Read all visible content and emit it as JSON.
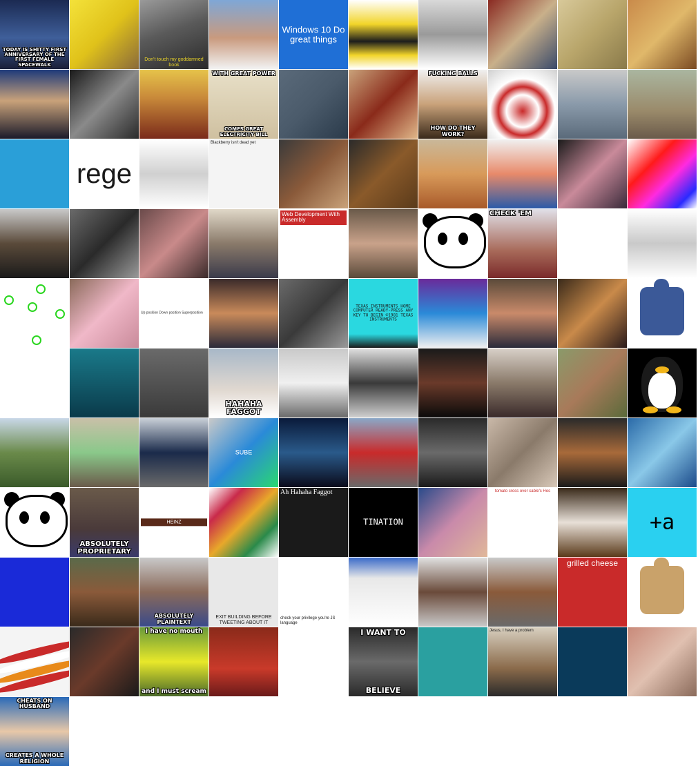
{
  "tiles": [
    {
      "name": "astronaut-group-photo",
      "bg": "linear-gradient(180deg,#1b2a52 0%,#3f5f9a 55%,#1a1f38 100%)",
      "cap_pos": "bottom",
      "cap_style": "meme",
      "cap_size": 7,
      "caption": "TODAY IS SHITTY FIRST ANNIVERSARY OF THE FIRST FEMALE SPACEWALK"
    },
    {
      "name": "yellow-mop-horse",
      "bg": "linear-gradient(135deg,#f4e23a 0%,#e0c21a 50%,#8a6a3a 100%)",
      "caption": ""
    },
    {
      "name": "black-book-on-floor",
      "bg": "linear-gradient(160deg,#9a9a9a 0%,#5a5a5a 45%,#2a2a2a 100%)",
      "cap_pos": "bottom",
      "cap_style": "plain",
      "cap_color": "#e8d22a",
      "cap_size": 7,
      "caption": "Don't touch my goddamned book"
    },
    {
      "name": "mother-teresa-portrait",
      "bg": "linear-gradient(180deg,#7fa7d6 0%,#c99a7e 55%,#f2f2f2 100%)",
      "caption": ""
    },
    {
      "name": "windows-10-banner",
      "bg": "#1f6fd6",
      "cap_pos": "center",
      "cap_style": "plain",
      "cap_color": "#ffffff",
      "cap_size": 13,
      "caption": "Windows 10 Do great things"
    },
    {
      "name": "bee-costume-figure",
      "bg": "linear-gradient(180deg,#ffffff 0%,#f2d52a 35%,#1c1c1c 60%,#f2d52a 80%,#ffffff 100%)",
      "caption": ""
    },
    {
      "name": "physicist-at-chalkboard",
      "bg": "linear-gradient(180deg,#d9d9d9 0%,#9a9a9a 50%,#ffffff 100%)",
      "caption": ""
    },
    {
      "name": "crowded-warehouse",
      "bg": "linear-gradient(135deg,#8a2a22 0%,#c9b08a 50%,#3a4a6a 100%)",
      "caption": ""
    },
    {
      "name": "isaac-newton-banknote",
      "bg": "linear-gradient(135deg,#d8c99a 0%,#b8a56a 50%,#8a7a4a 100%)",
      "caption": ""
    },
    {
      "name": "two-men-icon-painting",
      "bg": "linear-gradient(135deg,#c98a4a 0%,#e0b86a 50%,#7a4a22 100%)",
      "caption": ""
    },
    {
      "name": "politician-at-podium",
      "bg": "linear-gradient(180deg,#1e3a7a 0%,#c9a27a 45%,#1a1a2a 100%)",
      "caption": ""
    },
    {
      "name": "vintage-photo-child-and-man",
      "bg": "linear-gradient(135deg,#1a1a1a 0%,#8a8a8a 50%,#2a2a2a 100%)",
      "caption": ""
    },
    {
      "name": "fly-saint-icon-painting",
      "bg": "linear-gradient(180deg,#e6c34a 0%,#c98a3a 40%,#7a2a1a 100%)",
      "caption": ""
    },
    {
      "name": "confucius-meme",
      "bg": "linear-gradient(180deg,#e8e0c8 0%,#cfc0a0 100%)",
      "cap_pos": "top",
      "cap_style": "meme",
      "cap_size": 8,
      "caption": "WITH GREAT POWER",
      "cap2_pos": "bottom",
      "cap2_style": "meme",
      "cap2_size": 7,
      "caption2": "COMES GREAT ELECTRICITY BILL"
    },
    {
      "name": "black-puppy-on-floor",
      "bg": "linear-gradient(135deg,#5a6a7a 0%,#4a5a6a 50%,#2a3a4a 100%)",
      "caption": ""
    },
    {
      "name": "feet-in-slippers",
      "bg": "linear-gradient(135deg,#c9a27a 0%,#8a2a1a 50%,#e0b88a 100%)",
      "caption": ""
    },
    {
      "name": "dog-with-balls-meme",
      "bg": "linear-gradient(180deg,#f0f0f0 0%,#c9a27a 50%,#3a2a1a 100%)",
      "cap_pos": "top",
      "cap_style": "meme",
      "cap_size": 8,
      "caption": "FUCKING BALLS",
      "cap2_pos": "bottom",
      "cap2_style": "meme",
      "cap2_size": 8,
      "caption2": "HOW DO THEY WORK?"
    },
    {
      "name": "toy-helicopter-target",
      "bg": "radial-gradient(circle at 50% 60%,#c92a2a 0%,#ffffff 30%,#c92a2a 45%,#ffffff 60%,#d0d0d0 100%)",
      "caption": ""
    },
    {
      "name": "crowd-of-people-blurred",
      "bg": "linear-gradient(180deg,#c9c9c9 0%,#8a9aaa 50%,#5a6a7a 100%)",
      "caption": ""
    },
    {
      "name": "dog-on-street",
      "bg": "linear-gradient(180deg,#aab6a0 0%,#9a8a6a 60%,#6a5a4a 100%)",
      "caption": ""
    },
    {
      "name": "telegram-logo",
      "bg": "#2a9fd8",
      "caption": ""
    },
    {
      "name": "rege-text-tile",
      "bg": "#ffffff",
      "cap_pos": "center",
      "cap_style": "plain",
      "cap_color": "#1a1a1a",
      "cap_size": 40,
      "caption": "rege"
    },
    {
      "name": "comic-strip-panels",
      "bg": "linear-gradient(180deg,#ffffff 0%,#d0d0d0 50%,#ffffff 100%)",
      "caption": ""
    },
    {
      "name": "blackberry-note",
      "bg": "#f4f4f4",
      "cap_pos": "top",
      "cap_style": "plain",
      "cap_color": "#1a1a1a",
      "cap_size": 6,
      "cap_align": "left",
      "caption": "Blackberry isn't dead yet"
    },
    {
      "name": "cake-slice-photo",
      "bg": "linear-gradient(135deg,#3a3a3a 0%,#8a5a3a 50%,#c9a27a 100%)",
      "caption": ""
    },
    {
      "name": "dachshund-at-table",
      "bg": "linear-gradient(135deg,#2a2a2a 0%,#8a5a2a 50%,#5a3a1a 100%)",
      "caption": ""
    },
    {
      "name": "hotdog-dog",
      "bg": "linear-gradient(180deg,#c9b89a 0%,#d89a5a 50%,#a85a2a 100%)",
      "caption": ""
    },
    {
      "name": "cartoon-old-man",
      "bg": "linear-gradient(180deg,#f0f0f0 0%,#e88a6a 50%,#2a5aa8 100%)",
      "caption": ""
    },
    {
      "name": "two-people-expo",
      "bg": "linear-gradient(135deg,#1a1a1a 0%,#c98a9a 50%,#3a2a3a 100%)",
      "caption": ""
    },
    {
      "name": "colorful-geometric-pattern",
      "bg": "linear-gradient(135deg,#ffffff 0%,#ff1a1a 35%,#ff2ae0 60%,#2a2aff 85%,#ffffff 100%)",
      "caption": ""
    },
    {
      "name": "leader-portrait",
      "bg": "linear-gradient(180deg,#c9c9c9 0%,#5a4a3a 50%,#1a1a1a 100%)",
      "caption": ""
    },
    {
      "name": "robot-dog-parts",
      "bg": "linear-gradient(135deg,#6a6a6a 0%,#2a2a2a 50%,#9a9a9a 100%)",
      "caption": ""
    },
    {
      "name": "pig-close-up",
      "bg": "linear-gradient(135deg,#6a4a4a 0%,#c98a8a 50%,#3a2a2a 100%)",
      "caption": ""
    },
    {
      "name": "office-workers-desk",
      "bg": "linear-gradient(180deg,#e0d8c8 0%,#8a7a6a 50%,#3a3a4a 100%)",
      "caption": ""
    },
    {
      "name": "web-development-book-cover",
      "bg": "#ffffff",
      "cap_pos": "top",
      "cap_style": "plain",
      "cap_color": "#ffffff",
      "cap_bg": "#c92a2a",
      "cap_size": 8,
      "cap_align": "left",
      "caption": "Web Development With Assembly"
    },
    {
      "name": "close-up-face-portrait",
      "bg": "linear-gradient(180deg,#6a5a4a 0%,#c9a28a 50%,#5a4a3a 100%)",
      "caption": ""
    },
    {
      "name": "panda-drawing",
      "bg": "#ffffff",
      "panda": true,
      "caption": ""
    },
    {
      "name": "check-em-meme",
      "bg": "linear-gradient(180deg,#e0e0e8 0%,#a86a5a 60%,#7a2a2a 100%)",
      "cap_pos": "top",
      "cap_style": "meme",
      "cap_size": 10,
      "cap_align": "left",
      "caption": "CHECK 'EM"
    },
    {
      "name": "tweet-screenshot",
      "bg": "#ffffff",
      "cap_pos": "top",
      "cap_style": "plain",
      "cap_color": "#555555",
      "cap_size": 6,
      "cap_align": "left",
      "caption": ""
    },
    {
      "name": "sketch-illustration",
      "bg": "linear-gradient(180deg,#ffffff 0%,#c9c9c9 50%,#ffffff 100%)",
      "caption": ""
    },
    {
      "name": "green-circles",
      "bg": "#ffffff",
      "circles": true,
      "caption": ""
    },
    {
      "name": "woman-with-cat-ears",
      "bg": "linear-gradient(135deg,#8a6a5a 0%,#f0b8c8 50%,#c98a9a 100%)",
      "caption": ""
    },
    {
      "name": "usb-positions-diagram",
      "bg": "#ffffff",
      "cap_pos": "center",
      "cap_style": "plain",
      "cap_color": "#333333",
      "cap_size": 5,
      "cap_align": "left",
      "caption": "Up position Down position Superposition"
    },
    {
      "name": "family-in-costumes",
      "bg": "linear-gradient(180deg,#3a2a2a 0%,#c98a5a 50%,#2a2a3a 100%)",
      "caption": ""
    },
    {
      "name": "mech-robot-statue",
      "bg": "linear-gradient(135deg,#6a6a6a 0%,#3a3a3a 50%,#9a9a9a 100%)",
      "caption": ""
    },
    {
      "name": "texas-instruments-screen",
      "bg": "linear-gradient(180deg,#2ad8e0 0%,#2ad8e0 80%,#1a1a1a 100%)",
      "cap_pos": "center",
      "cap_style": "plain",
      "cap_color": "#1a1a1a",
      "cap_size": 6,
      "cap_extra": "mono",
      "caption": "TEXAS INSTRUMENTS HOME COMPUTER READY-PRESS ANY KEY TO BEGIN ©1981 TEXAS INSTRUMENTS"
    },
    {
      "name": "purple-website-screenshot",
      "bg": "linear-gradient(180deg,#6a2a9a 0%,#2a8ad8 50%,#f0f0f0 100%)",
      "caption": ""
    },
    {
      "name": "man-at-desk-office",
      "bg": "linear-gradient(180deg,#5a4a3a 0%,#c98a6a 50%,#2a2a3a 100%)",
      "caption": ""
    },
    {
      "name": "electronics-on-table",
      "bg": "linear-gradient(135deg,#3a2a1a 0%,#c98a4a 50%,#2a1a1a 100%)",
      "caption": ""
    },
    {
      "name": "broken-thumbs-up-icon",
      "bg": "#ffffff",
      "thumb": "bandaged",
      "caption": ""
    },
    {
      "name": "biology-diagram-cat-woman",
      "bg": "#ffffff",
      "caption": ""
    },
    {
      "name": "underwater-dog",
      "bg": "linear-gradient(180deg,#1a7a8a 0%,#0a3a4a 100%)",
      "caption": ""
    },
    {
      "name": "group-of-men-room",
      "bg": "linear-gradient(180deg,#6a6a6a 0%,#3a3a3a 100%)",
      "caption": ""
    },
    {
      "name": "pope-laughing-meme",
      "bg": "linear-gradient(180deg,#a8b8c8 0%,#e0d8d0 60%,#ffffff 100%)",
      "cap_pos": "bottom",
      "cap_style": "meme",
      "cap_size": 11,
      "caption": "HAHAHA FAGGOT"
    },
    {
      "name": "news-van",
      "bg": "linear-gradient(180deg,#c9c9c9 0%,#f0f0f0 50%,#6a6a6a 100%)",
      "caption": ""
    },
    {
      "name": "isaac-newton-engraving",
      "bg": "linear-gradient(180deg,#e0e0e0 0%,#3a3a3a 50%,#d0d0d0 100%)",
      "caption": ""
    },
    {
      "name": "chocolate-bunny",
      "bg": "linear-gradient(180deg,#1a1a1a 0%,#6a3a2a 50%,#0a0a0a 100%)",
      "caption": ""
    },
    {
      "name": "conference-presenter",
      "bg": "linear-gradient(180deg,#d8d0c8 0%,#8a7a6a 50%,#3a2a2a 100%)",
      "caption": ""
    },
    {
      "name": "monkey-in-field",
      "bg": "linear-gradient(135deg,#8a9a6a 0%,#a87a5a 50%,#5a6a3a 100%)",
      "caption": ""
    },
    {
      "name": "linux-tux-penguin",
      "bg": "#000000",
      "tux": true,
      "caption": ""
    },
    {
      "name": "boy-with-blue-barrel",
      "bg": "linear-gradient(180deg,#c9d8e8 0%,#6a8a4a 50%,#3a5a2a 100%)",
      "caption": ""
    },
    {
      "name": "sticky-notes-office",
      "bg": "linear-gradient(180deg,#c9c0a8 0%,#8ac88a 50%,#6a5a4a 100%)",
      "caption": ""
    },
    {
      "name": "police-on-motorcycles",
      "bg": "linear-gradient(180deg,#c9d0d8 0%,#1a2a4a 50%,#6a6a6a 100%)",
      "caption": ""
    },
    {
      "name": "sube-card-hand",
      "bg": "linear-gradient(135deg,#c9c9c9 0%,#2a8ad8 50%,#2ad870 100%)",
      "cap_pos": "center",
      "cap_style": "plain",
      "cap_color": "#ffffff",
      "cap_size": 9,
      "caption": "SUBE"
    },
    {
      "name": "ship-in-storm",
      "bg": "linear-gradient(180deg,#0a1a3a 0%,#2a5a8a 50%,#0a0a1a 100%)",
      "caption": ""
    },
    {
      "name": "wrecked-train-cars",
      "bg": "linear-gradient(180deg,#8aa8c8 0%,#c92a2a 50%,#6a6a6a 100%)",
      "caption": ""
    },
    {
      "name": "cracked-laptop",
      "bg": "linear-gradient(180deg,#2a2a2a 0%,#6a6a6a 50%,#1a1a1a 100%)",
      "caption": ""
    },
    {
      "name": "sleeping-cat-grenade",
      "bg": "linear-gradient(135deg,#c9b8a8 0%,#8a7a6a 50%,#d8c8b8 100%)",
      "caption": ""
    },
    {
      "name": "dog-close-up",
      "bg": "linear-gradient(180deg,#2a2a2a 0%,#a86a3a 50%,#1a1a1a 100%)",
      "caption": ""
    },
    {
      "name": "airplane-contrail",
      "bg": "linear-gradient(135deg,#2a6aa8 0%,#8ac8e8 50%,#1a4a8a 100%)",
      "caption": ""
    },
    {
      "name": "panda-sketch-window",
      "bg": "#ffffff",
      "panda": true,
      "caption": ""
    },
    {
      "name": "absolutely-proprietary-meme",
      "bg": "linear-gradient(180deg,#6a5a4a 0%,#4a3a3a 60%,#3a3a6a 100%)",
      "cap_pos": "bottom",
      "cap_style": "meme",
      "cap_size": 10,
      "caption": "ABSOLUTELY PROPRIETARY"
    },
    {
      "name": "heinz-sauce-bottle",
      "bg": "#ffffff",
      "cap_pos": "center",
      "cap_style": "plain",
      "cap_color": "#ffffff",
      "cap_bg": "#5a2a1a",
      "cap_size": 7,
      "caption": "HEINZ"
    },
    {
      "name": "dice-grid-pattern",
      "bg": "linear-gradient(135deg,#ffffff 0%,#c92a4a 25%,#e8a82a 50%,#2a8a4a 75%,#ffffff 100%)",
      "caption": ""
    },
    {
      "name": "mother-teresa-meme",
      "bg": "#1a1a1a",
      "cap_pos": "top",
      "cap_style": "plain",
      "cap_color": "#ffffff",
      "cap_size": 10,
      "cap_extra": "serif",
      "cap_align": "left",
      "caption": "Ah Hahaha Faggot"
    },
    {
      "name": "pixel-destination-text",
      "bg": "#000000",
      "cap_pos": "center",
      "cap_style": "plain",
      "cap_color": "#ffffff",
      "cap_size": 12,
      "cap_extra": "mono",
      "caption": "TINATION"
    },
    {
      "name": "pixelated-face",
      "bg": "linear-gradient(135deg,#2a4a8a 0%,#c98aaa 50%,#e0b89a 100%)",
      "caption": ""
    },
    {
      "name": "grid-of-figures-chart",
      "bg": "#ffffff",
      "cap_pos": "top",
      "cap_style": "plain",
      "cap_color": "#c92a2a",
      "cap_size": 6,
      "caption": "tomato cross over cable's Hos"
    },
    {
      "name": "rabbit-in-teacup",
      "bg": "linear-gradient(180deg,#3a2a1a 0%,#e8e0d8 50%,#5a3a1a 100%)",
      "caption": ""
    },
    {
      "name": "pixel-art-text-cyan",
      "bg": "#2ad0f0",
      "cap_pos": "center",
      "cap_style": "plain",
      "cap_color": "#000000",
      "cap_size": 30,
      "cap_extra": "mono",
      "caption": "+a"
    },
    {
      "name": "blue-error-screen",
      "bg": "#1a2ad8",
      "cap_pos": "center",
      "cap_style": "plain",
      "cap_color": "#ffffff",
      "cap_size": 5,
      "cap_extra": "mono",
      "caption": ""
    },
    {
      "name": "religious-painting-man",
      "bg": "linear-gradient(180deg,#5a6a4a 0%,#8a5a3a 50%,#3a2a1a 100%)",
      "caption": ""
    },
    {
      "name": "absolutely-plaintext-meme",
      "bg": "linear-gradient(180deg,#c9c9c9 0%,#8a6a5a 50%,#3a4a8a 100%)",
      "cap_pos": "bottom",
      "cap_style": "meme",
      "cap_size": 8,
      "caption": "ABSOLUTELY PLAINTEXT"
    },
    {
      "name": "exit-building-sign",
      "bg": "#e8e8e8",
      "cap_pos": "bottom",
      "cap_style": "plain",
      "cap_color": "#1a1a1a",
      "cap_size": 7,
      "caption": "EXIT BUILDING BEFORE TWEETING ABOUT IT"
    },
    {
      "name": "check-your-privilege-js",
      "bg": "#ffffff",
      "cap_pos": "bottom",
      "cap_style": "plain",
      "cap_color": "#1a1a1a",
      "cap_size": 6,
      "cap_align": "left",
      "caption": "check your privilege you're JS language"
    },
    {
      "name": "windows-dialog-screenshot",
      "bg": "linear-gradient(180deg,#3a6ac8 0%,#e8e8e8 30%,#ffffff 100%)",
      "caption": ""
    },
    {
      "name": "woman-at-computer",
      "bg": "linear-gradient(180deg,#e0e0e0 0%,#6a4a3a 50%,#c9c9c9 100%)",
      "caption": ""
    },
    {
      "name": "woman-with-laptop",
      "bg": "linear-gradient(180deg,#c9c9c9 0%,#8a5a3a 50%,#6a6a6a 100%)",
      "caption": ""
    },
    {
      "name": "grilled-cheese-ad",
      "bg": "#c92a2a",
      "cap_pos": "top",
      "cap_style": "plain",
      "cap_color": "#ffffff",
      "cap_size": 12,
      "caption": "grilled cheese"
    },
    {
      "name": "wooden-thumbs-up",
      "bg": "#ffffff",
      "thumb": "wood",
      "caption": ""
    },
    {
      "name": "red-wavy-stripes",
      "bg": "#f4f4f4",
      "stripes": true,
      "caption": ""
    },
    {
      "name": "dog-face-close",
      "bg": "linear-gradient(135deg,#2a2a2a 0%,#6a3a2a 50%,#1a1a1a 100%)",
      "caption": ""
    },
    {
      "name": "no-mouth-must-scream",
      "bg": "linear-gradient(180deg,#6a9a3a 0%,#e8e82a 50%,#4a6a2a 100%)",
      "cap_pos": "top",
      "cap_style": "meme",
      "cap_size": 9,
      "caption": "I have no mouth",
      "cap2_pos": "bottom",
      "cap2_style": "meme",
      "cap2_size": 9,
      "caption2": "and I must scream"
    },
    {
      "name": "red-room-photo",
      "bg": "linear-gradient(180deg,#8a2a1a 0%,#c93a2a 60%,#6a1a1a 100%)",
      "caption": ""
    },
    {
      "name": "paper-cutter",
      "bg": "#ffffff",
      "caption": ""
    },
    {
      "name": "i-want-to-believe",
      "bg": "linear-gradient(180deg,#2a2a2a 0%,#6a6a6a 50%,#2a2a2a 100%)",
      "cap_pos": "top",
      "cap_style": "meme",
      "cap_size": 11,
      "caption": "I WANT TO",
      "cap2_pos": "bottom",
      "cap2_style": "meme",
      "cap2_size": 11,
      "caption2": "BELIEVE"
    },
    {
      "name": "couple-selfie-illustration",
      "bg": "#2aa0a0",
      "caption": ""
    },
    {
      "name": "jesus-dog-meme",
      "bg": "linear-gradient(180deg,#d8d0c0 0%,#8a6a4a 60%,#2a2a2a 100%)",
      "cap_pos": "top",
      "cap_style": "plain",
      "cap_color": "#1a1a1a",
      "cap_size": 6,
      "cap_align": "left",
      "caption": "Jesus, I have a problem"
    },
    {
      "name": "dark-blue-screen",
      "bg": "#0a3a5a",
      "cap_pos": "center",
      "cap_style": "plain",
      "cap_color": "#c9d8e8",
      "cap_size": 4,
      "caption": ""
    },
    {
      "name": "man-with-cart",
      "bg": "linear-gradient(135deg,#c98a7a 0%,#e0c0b0 50%,#8a6a5a 100%)",
      "caption": ""
    },
    {
      "name": "sacred-heart-meme",
      "bg": "linear-gradient(180deg,#2a6ab8 0%,#e8c8a8 50%,#2a6ab8 100%)",
      "cap_pos": "top",
      "cap_style": "meme",
      "cap_size": 8,
      "caption": "CHEATS ON HUSBAND",
      "cap2_pos": "bottom",
      "cap2_style": "meme",
      "cap2_size": 8,
      "caption2": "CREATES A WHOLE RELIGION"
    }
  ]
}
